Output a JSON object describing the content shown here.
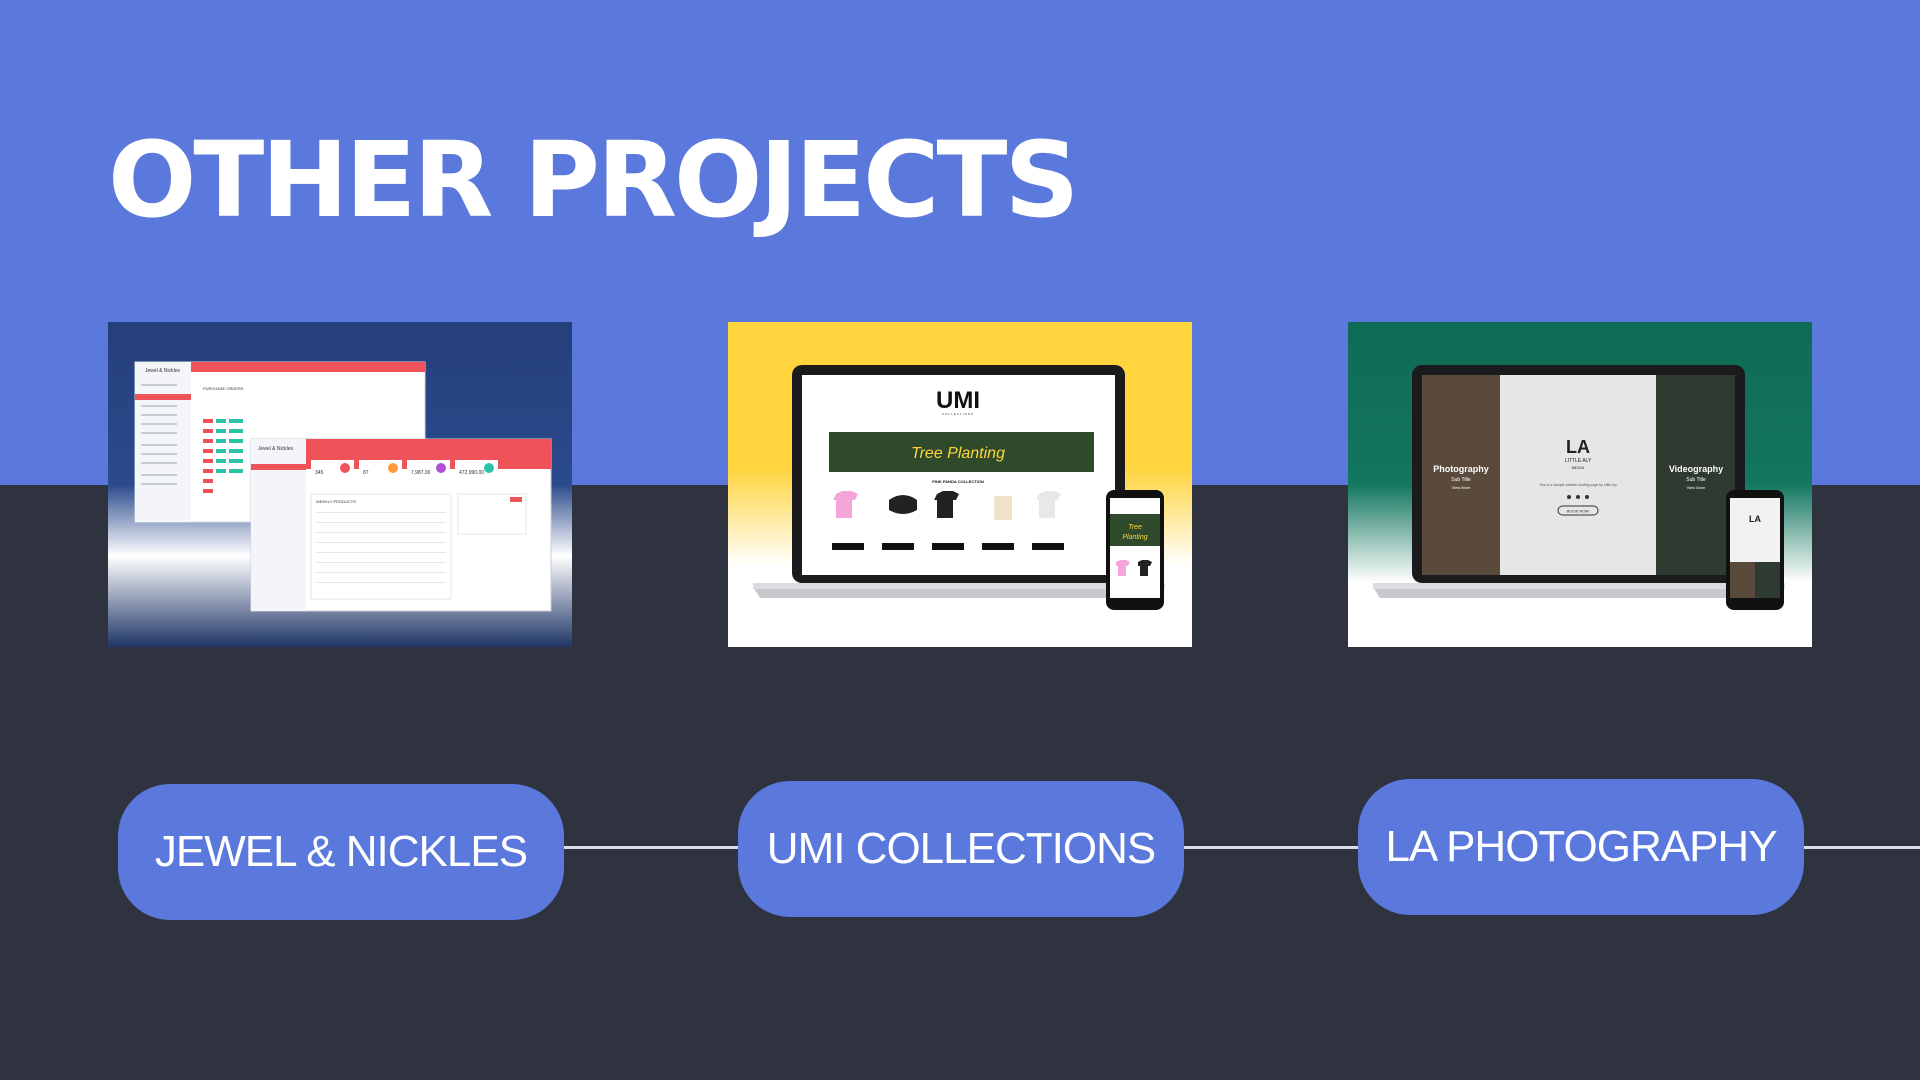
{
  "slide": {
    "title": "OTHER PROJECTS",
    "colors": {
      "band": "#5b78dc",
      "background": "#2e333f",
      "pill": "#5b78dc"
    }
  },
  "projects": [
    {
      "label": "JEWEL & NICKLES",
      "preview": {
        "brand": "Jewel & Nickles",
        "section": "PURCHASE ORDERS",
        "list_title": "WEEKLY PRODUCTS",
        "stats": [
          "345",
          "87",
          "7,987.00",
          "472,990.00"
        ],
        "accent": "#f0525a"
      }
    },
    {
      "label": "UMI COLLECTIONS",
      "preview": {
        "logo": "UMI",
        "logo_sub": "COLLECTIONS",
        "banner": "Tree Planting",
        "collection": "PINK PANDA COLLECTION",
        "products": [
          "Pink Panda Cotton Shirt",
          "Pink Panda Umbrella",
          "Pink Panda Dri Fit Shirt",
          "Pink Panda Bag",
          "Pink Panda Dri Fit Shirt"
        ],
        "cta": "ADD TO CART"
      }
    },
    {
      "label": "LA PHOTOGRAPHY",
      "preview": {
        "left_title": "Photography",
        "right_title": "Videography",
        "sub_title": "Sub Title",
        "more": "View More",
        "logo": "LA",
        "logo_sub": "LITTLE ALY",
        "logo_sub2": "MEDIA",
        "tagline": "This is a sample website landing page by Little Aly",
        "cta": "BOOK NOW"
      }
    }
  ]
}
